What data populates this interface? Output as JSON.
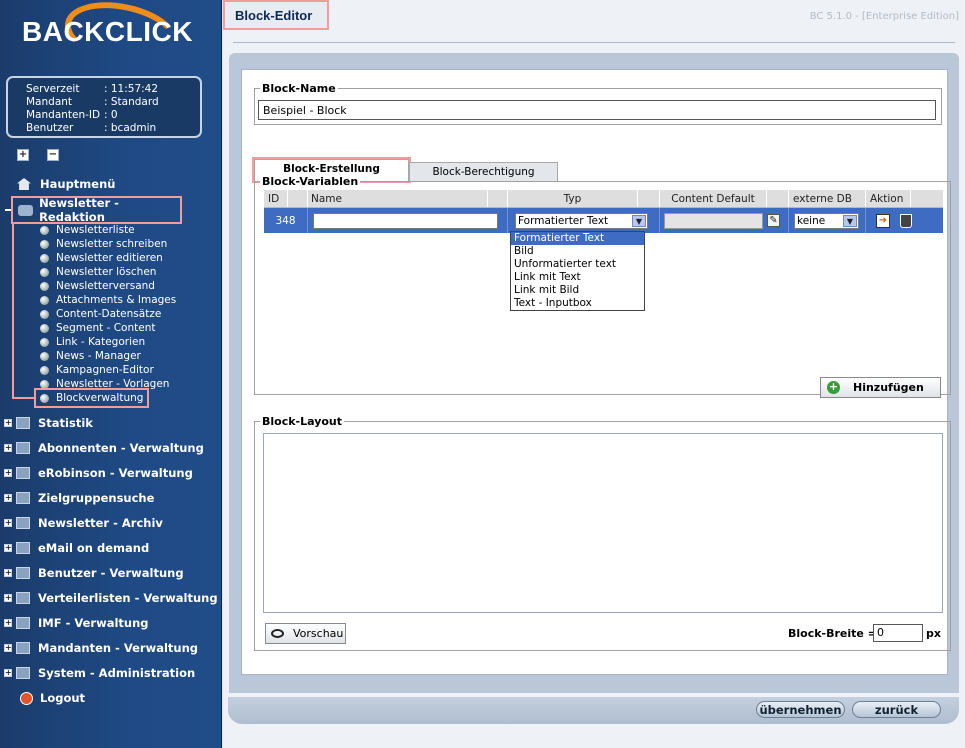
{
  "app": {
    "logo": "BACKCLICK",
    "version": "BC 5.1.0 - [Enterprise Edition]"
  },
  "info": [
    {
      "label": "Serverzeit",
      "value": ": 11:57:42"
    },
    {
      "label": "Mandant",
      "value": ": Standard"
    },
    {
      "label": "Mandanten-ID",
      "value": ": 0"
    },
    {
      "label": "Benutzer",
      "value": ": bcadmin"
    }
  ],
  "tree_tools": {
    "expand": "+",
    "collapse": "−"
  },
  "nav": {
    "home": "Hauptmenü",
    "newsletter_redaktion": "Newsletter - Redaktion",
    "sub_items": [
      "Newsletterliste",
      "Newsletter schreiben",
      "Newsletter editieren",
      "Newsletter löschen",
      "Newsletterversand",
      "Attachments & Images",
      "Content-Datensätze",
      "Segment - Content",
      "Link - Kategorien",
      "News - Manager",
      "Kampagnen-Editor",
      "Newsletter - Vorlagen",
      "Blockverwaltung"
    ],
    "groups": [
      "Statistik",
      "Abonnenten - Verwaltung",
      "eRobinson - Verwaltung",
      "Zielgruppensuche",
      "Newsletter - Archiv",
      "eMail on demand",
      "Benutzer - Verwaltung",
      "Verteilerlisten - Verwaltung",
      "IMF - Verwaltung",
      "Mandanten - Verwaltung",
      "System - Administration"
    ],
    "logout": "Logout"
  },
  "page": {
    "title": "Block-Editor"
  },
  "block_name": {
    "legend": "Block-Name",
    "value": "Beispiel - Block"
  },
  "tabs": {
    "creation": "Block-Erstellung",
    "permission": "Block-Berechtigung"
  },
  "variables": {
    "legend": "Block-Variablen",
    "headers": {
      "id": "ID",
      "name": "Name",
      "type": "Typ",
      "content": "Content Default",
      "external": "externe DB",
      "action": "Aktion"
    },
    "row": {
      "id": "348",
      "name": "",
      "type": "Formatierter Text",
      "content": "",
      "external": "keine"
    },
    "type_options": [
      "Formatierter Text",
      "Bild",
      "Unformatierter text",
      "Link mit Text",
      "Link mit Bild",
      "Text - Inputbox"
    ],
    "add_button": "Hinzufügen"
  },
  "layout": {
    "legend": "Block-Layout",
    "preview_button": "Vorschau",
    "width_label": "Block-Breite =",
    "width_value": "0",
    "width_unit": "px"
  },
  "footer": {
    "apply": "übernehmen",
    "back": "zurück"
  },
  "colors": {
    "sidebar": "#1f4a85",
    "selected_row": "#3d6cc2",
    "highlight": "#f49b9b",
    "logo_accent": "#f08c1a"
  }
}
